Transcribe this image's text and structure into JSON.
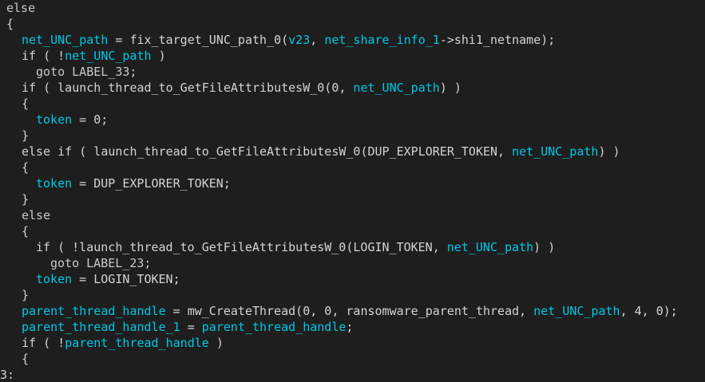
{
  "colors": {
    "background": "#1e1e1e",
    "text": "#d4d4d4",
    "variable": "#00c8e6"
  },
  "code_lines": [
    [
      {
        "t": "else",
        "k": "kw"
      }
    ],
    [
      {
        "t": "{",
        "k": "plain"
      }
    ],
    [
      {
        "t": "net_UNC_path",
        "k": "var"
      },
      {
        "t": " = fix_target_UNC_path_0(",
        "k": "plain"
      },
      {
        "t": "v23",
        "k": "var"
      },
      {
        "t": ", ",
        "k": "plain"
      },
      {
        "t": "net_share_info_1",
        "k": "var"
      },
      {
        "t": "->shi1_netname);",
        "k": "plain"
      }
    ],
    [
      {
        "t": "if ( !",
        "k": "plain"
      },
      {
        "t": "net_UNC_path",
        "k": "var"
      },
      {
        "t": " )",
        "k": "plain"
      }
    ],
    [
      {
        "t": "goto LABEL_33;",
        "k": "label"
      }
    ],
    [
      {
        "t": "if ( launch_thread_to_GetFileAttributesW_0(0, ",
        "k": "plain"
      },
      {
        "t": "net_UNC_path",
        "k": "var"
      },
      {
        "t": ") )",
        "k": "plain"
      }
    ],
    [
      {
        "t": "{",
        "k": "plain"
      }
    ],
    [
      {
        "t": "token",
        "k": "var"
      },
      {
        "t": " = 0;",
        "k": "plain"
      }
    ],
    [
      {
        "t": "}",
        "k": "plain"
      }
    ],
    [
      {
        "t": "else if ( launch_thread_to_GetFileAttributesW_0(DUP_EXPLORER_TOKEN, ",
        "k": "plain"
      },
      {
        "t": "net_UNC_path",
        "k": "var"
      },
      {
        "t": ") )",
        "k": "plain"
      }
    ],
    [
      {
        "t": "{",
        "k": "plain"
      }
    ],
    [
      {
        "t": "token",
        "k": "var"
      },
      {
        "t": " = DUP_EXPLORER_TOKEN;",
        "k": "plain"
      }
    ],
    [
      {
        "t": "}",
        "k": "plain"
      }
    ],
    [
      {
        "t": "else",
        "k": "kw"
      }
    ],
    [
      {
        "t": "{",
        "k": "plain"
      }
    ],
    [
      {
        "t": "if ( !launch_thread_to_GetFileAttributesW_0(LOGIN_TOKEN, ",
        "k": "plain"
      },
      {
        "t": "net_UNC_path",
        "k": "var"
      },
      {
        "t": ") )",
        "k": "plain"
      }
    ],
    [
      {
        "t": "goto LABEL_23;",
        "k": "label"
      }
    ],
    [
      {
        "t": "token",
        "k": "var"
      },
      {
        "t": " = LOGIN_TOKEN;",
        "k": "plain"
      }
    ],
    [
      {
        "t": "}",
        "k": "plain"
      }
    ],
    [
      {
        "t": "parent_thread_handle",
        "k": "var"
      },
      {
        "t": " = mw_CreateThread(0, 0, ransomware_parent_thread, ",
        "k": "plain"
      },
      {
        "t": "net_UNC_path",
        "k": "var"
      },
      {
        "t": ", 4, 0);",
        "k": "plain"
      }
    ],
    [
      {
        "t": "parent_thread_handle_1",
        "k": "var"
      },
      {
        "t": " = ",
        "k": "plain"
      },
      {
        "t": "parent_thread_handle",
        "k": "var"
      },
      {
        "t": ";",
        "k": "plain"
      }
    ],
    [
      {
        "t": "if ( !",
        "k": "plain"
      },
      {
        "t": "parent_thread_handle",
        "k": "var"
      },
      {
        "t": " )",
        "k": "plain"
      }
    ],
    [
      {
        "t": "{",
        "k": "plain"
      }
    ],
    [
      {
        "t": "3:",
        "k": "plain"
      }
    ]
  ]
}
